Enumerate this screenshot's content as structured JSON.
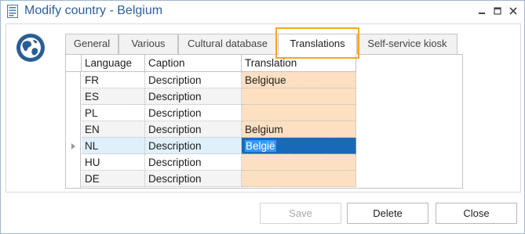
{
  "window": {
    "title": "Modify country - Belgium",
    "icons": {
      "app": "document-icon",
      "minimize": "minimize-icon",
      "maximize": "maximize-icon",
      "close": "close-icon"
    }
  },
  "panel": {
    "icon": "globe-icon"
  },
  "tabs": [
    {
      "label": "General",
      "active": false
    },
    {
      "label": "Various",
      "active": false
    },
    {
      "label": "Cultural database",
      "active": false
    },
    {
      "label": "Translations",
      "active": true
    },
    {
      "label": "Self-service kiosk",
      "active": false
    }
  ],
  "grid": {
    "columns": [
      "Language",
      "Caption",
      "Translation"
    ],
    "rows": [
      {
        "language": "FR",
        "caption": "Description",
        "translation": "Belgique"
      },
      {
        "language": "ES",
        "caption": "Description",
        "translation": ""
      },
      {
        "language": "PL",
        "caption": "Description",
        "translation": ""
      },
      {
        "language": "EN",
        "caption": "Description",
        "translation": "Belgium"
      },
      {
        "language": "NL",
        "caption": "Description",
        "translation": "België"
      },
      {
        "language": "HU",
        "caption": "Description",
        "translation": ""
      },
      {
        "language": "DE",
        "caption": "Description",
        "translation": ""
      }
    ],
    "selected_row": 4,
    "colors": {
      "translation_bg": "#fde0c2",
      "selection": "#1969b8",
      "highlight": "#f5a623"
    }
  },
  "buttons": {
    "save": {
      "label": "Save",
      "enabled": false
    },
    "delete": {
      "label": "Delete",
      "enabled": true
    },
    "close": {
      "label": "Close",
      "enabled": true
    }
  }
}
